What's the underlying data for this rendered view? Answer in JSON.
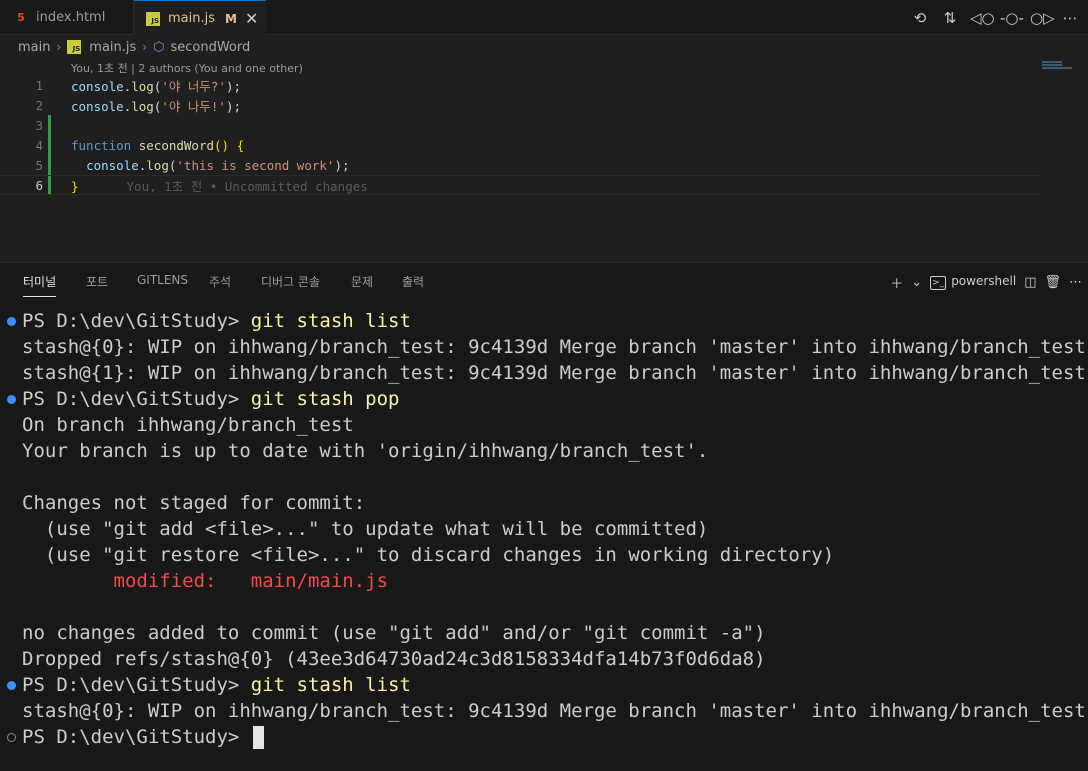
{
  "tabs": [
    {
      "label": "index.html",
      "icon": "html5-icon"
    },
    {
      "label": "main.js",
      "icon": "js-icon",
      "badge": "M"
    }
  ],
  "tab_actions": [
    "history-icon",
    "compare-changes-icon",
    "git-commit-prev-icon",
    "git-commit-icon",
    "git-commit-next-icon",
    "more-icon"
  ],
  "breadcrumb": {
    "folder": "main",
    "file": "main.js",
    "symbol": "secondWord"
  },
  "blame_header": "You, 1초 전 | 2 authors (You and one other)",
  "code": {
    "line_numbers": [
      "1",
      "2",
      "3",
      "4",
      "5",
      "6"
    ],
    "line1": {
      "obj": "console",
      "fn": "log",
      "str": "'야 너두?'"
    },
    "line2": {
      "obj": "console",
      "fn": "log",
      "str": "'야 나두!'"
    },
    "line4": {
      "kw": "function",
      "fn": "secondWord"
    },
    "line5": {
      "obj": "console",
      "fn": "log",
      "str": "'this is second work'"
    },
    "inline_blame": "You, 1초 전 • Uncommitted changes"
  },
  "panel": {
    "tabs": [
      "터미널",
      "포트",
      "GITLENS",
      "주석",
      "디버그 콘솔",
      "문제",
      "출력"
    ],
    "active_tab": "터미널",
    "shell_label": "powershell"
  },
  "terminal": {
    "prompt": "PS D:\\dev\\GitStudy> ",
    "cmd1": "git stash list",
    "out1": "stash@{0}: WIP on ihhwang/branch_test: 9c4139d Merge branch 'master' into ihhwang/branch_test",
    "out2": "stash@{1}: WIP on ihhwang/branch_test: 9c4139d Merge branch 'master' into ihhwang/branch_test",
    "cmd2": "git stash pop",
    "out3": "On branch ihhwang/branch_test",
    "out4": "Your branch is up to date with 'origin/ihhwang/branch_test'.",
    "out5": "Changes not staged for commit:",
    "out6": "  (use \"git add <file>...\" to update what will be committed)",
    "out7": "  (use \"git restore <file>...\" to discard changes in working directory)",
    "out8": "        modified:   main/main.js",
    "out9": "no changes added to commit (use \"git add\" and/or \"git commit -a\")",
    "out10": "Dropped refs/stash@{0} (43ee3d64730ad24c3d8158334dfa14b73f0d6da8)",
    "cmd3": "git stash list",
    "out11": "stash@{0}: WIP on ihhwang/branch_test: 9c4139d Merge branch 'master' into ihhwang/branch_test"
  },
  "colors": {
    "accent": "#0078d4",
    "modified": "#e2c08d",
    "terminal_command": "#f9f1a5",
    "terminal_error": "#f14c4c",
    "decoration_blue": "#3794ff"
  }
}
